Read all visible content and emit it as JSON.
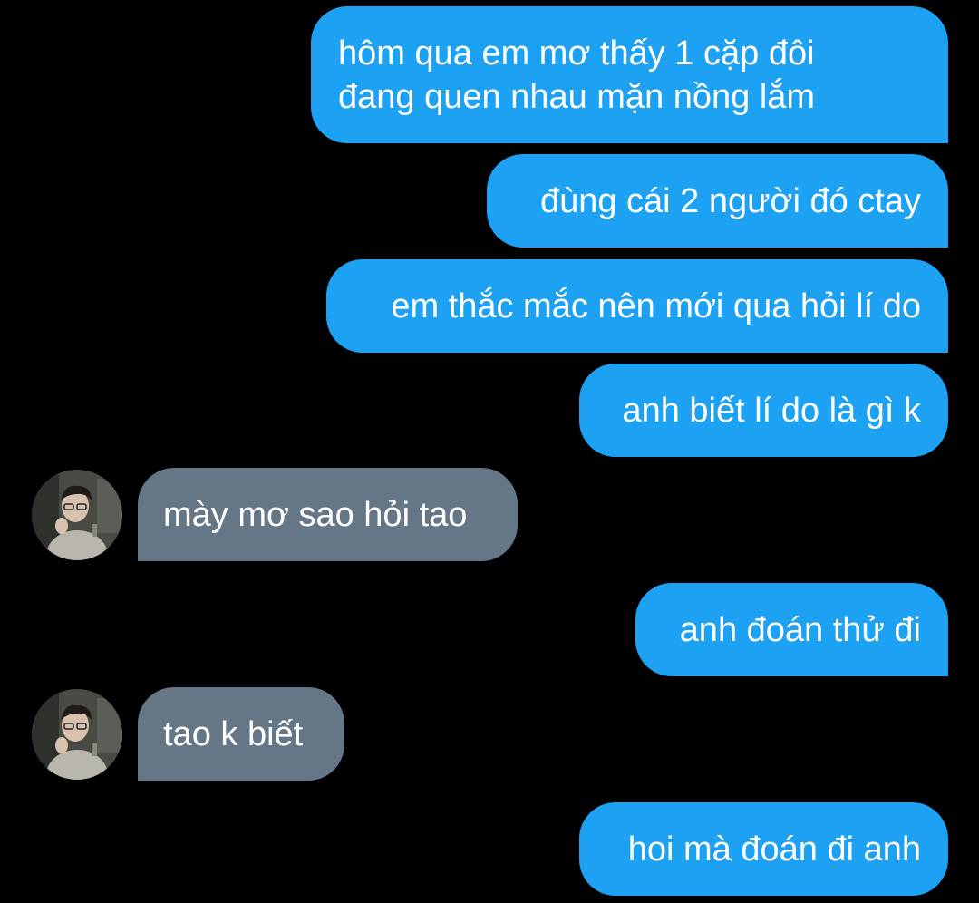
{
  "colors": {
    "background": "#000000",
    "sent_bubble": "#1da1f2",
    "received_bubble": "#657786",
    "text": "#ffffff"
  },
  "messages": [
    {
      "sender": "me",
      "text": "hôm qua em mơ thấy 1 cặp đôi\nđang quen nhau mặn nồng lắm"
    },
    {
      "sender": "me",
      "text": "đùng cái 2 người đó ctay"
    },
    {
      "sender": "me",
      "text": "em thắc mắc nên mới qua hỏi lí do"
    },
    {
      "sender": "me",
      "text": "anh biết lí do là gì k"
    },
    {
      "sender": "other",
      "avatar_icon": "user-avatar-photo",
      "text": "mày mơ sao hỏi tao"
    },
    {
      "sender": "me",
      "text": "anh đoán thử đi"
    },
    {
      "sender": "other",
      "avatar_icon": "user-avatar-photo",
      "text": "tao k biết"
    },
    {
      "sender": "me",
      "text": "hoi mà đoán đi anh"
    }
  ]
}
